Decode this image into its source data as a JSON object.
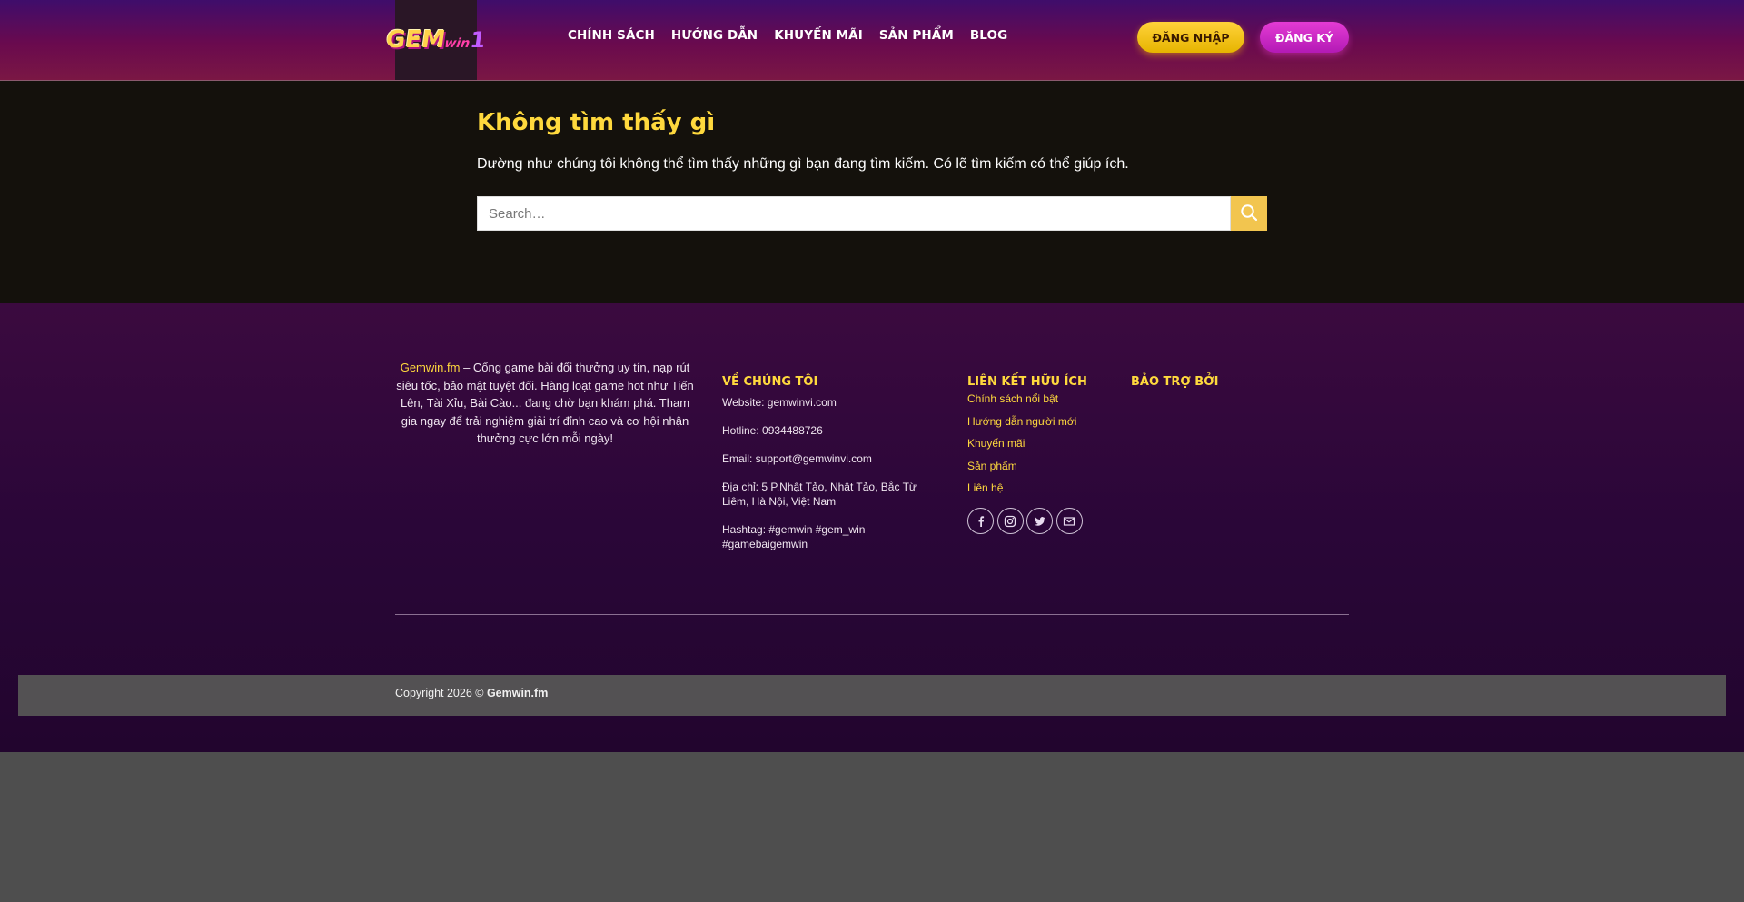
{
  "header": {
    "logo_name": "gemwin-logo",
    "nav": [
      {
        "label": "CHÍNH SÁCH"
      },
      {
        "label": "HƯỚNG DẪN"
      },
      {
        "label": "KHUYẾN MÃI"
      },
      {
        "label": "SẢN PHẨM"
      },
      {
        "label": "BLOG"
      }
    ],
    "login_label": "ĐĂNG NHẬP",
    "register_label": "ĐĂNG KÝ"
  },
  "main": {
    "title": "Không tìm thấy gì",
    "description": "Dường như chúng tôi không thể tìm thấy những gì bạn đang tìm kiếm. Có lẽ tìm kiếm có thể giúp ích.",
    "search_placeholder": "Search…",
    "search_icon": "search-icon"
  },
  "footer": {
    "about_brand": "Gemwin.fm",
    "about_text": " – Cổng game bài đổi thưởng uy tín, nạp rút siêu tốc, bảo mật tuyệt đối. Hàng loạt game hot như Tiến Lên, Tài Xỉu, Bài Cào... đang chờ bạn khám phá. Tham gia ngay để trải nghiệm giải trí đỉnh cao và cơ hội nhận thưởng cực lớn mỗi ngày!",
    "about_title": "VỀ CHÚNG TÔI",
    "website": "Website: gemwinvi.com",
    "hotline": "Hotline: 0934488726",
    "email": "Email: support@gemwinvi.com",
    "address": "Địa chỉ: 5 P.Nhật Tảo, Nhật Tảo, Bắc Từ Liêm, Hà Nội, Việt Nam",
    "hashtag": "Hashtag: #gemwin #gem_win #gamebaigemwin",
    "links_title": "LIÊN KẾT HỮU ÍCH",
    "links": [
      {
        "label": "Chính sách nổi bật"
      },
      {
        "label": "Hướng dẫn người mới"
      },
      {
        "label": "Khuyến mãi"
      },
      {
        "label": "Sản phẩm"
      },
      {
        "label": "Liên hệ"
      }
    ],
    "socials": [
      "facebook-icon",
      "instagram-icon",
      "twitter-icon",
      "email-icon"
    ],
    "sponsor_title": "BẢO TRỢ BỞI",
    "copyright_prefix": "Copyright 2026 © ",
    "copyright_brand": "Gemwin.fm"
  },
  "colors": {
    "accent_yellow": "#ffd93d",
    "login_button": "#f5c518",
    "register_button": "#d42fcf",
    "footer_bg": "#2a0638",
    "main_bg": "#14110c"
  }
}
